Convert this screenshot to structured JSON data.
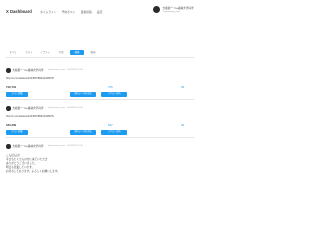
{
  "header": {
    "logo": "X Dashboard",
    "nav": [
      "タイムライン",
      "予約ポスト",
      "自動投稿",
      "設定"
    ],
    "active_nav_index": -1,
    "user": {
      "name": "大和屋ー 'm+森林大学円寺'",
      "handle": "@yamatoya_mori"
    }
  },
  "tabs": [
    "すべて",
    "ポスト",
    "リプライ",
    "引用",
    "画像",
    "動画"
  ],
  "active_tab": 4,
  "cards": [
    {
      "author": "大和屋ー 'm+森林大学円寺'",
      "meta": "@yamatoya_mori · 2024/3/20 10:00",
      "lines": [
        "http://x.com/status/123456789012345678"
      ],
      "left_metric": "749,734",
      "mid_metric": "376",
      "right_metric": "29",
      "buttons": [
        "ポスト詳細",
        "分析データを見る",
        "リポスト分析"
      ]
    },
    {
      "author": "大和屋ー 'm+森林大学円寺'",
      "meta": "@yamatoya_mori · 2024/3/19 18:30",
      "lines": [
        "http://x.com/status/123456789012345679"
      ],
      "left_metric": "180,309",
      "mid_metric": "547",
      "right_metric": "30",
      "buttons": [
        "ポスト詳細",
        "分析データを見る",
        "リポスト分析"
      ]
    },
    {
      "author": "大和屋ー 'm+森林大学円寺'",
      "meta": "@yamatoya_mori · 2024/3/18 21:15",
      "lines": [
        "こんばんは！",
        "今日もたくさんの方に来ていただき",
        "ありがとうございました。",
        "明日も営業しています。",
        "お待ちしております。よろしくお願いします。"
      ],
      "left_metric": "",
      "mid_metric": "",
      "right_metric": "",
      "buttons": []
    }
  ]
}
